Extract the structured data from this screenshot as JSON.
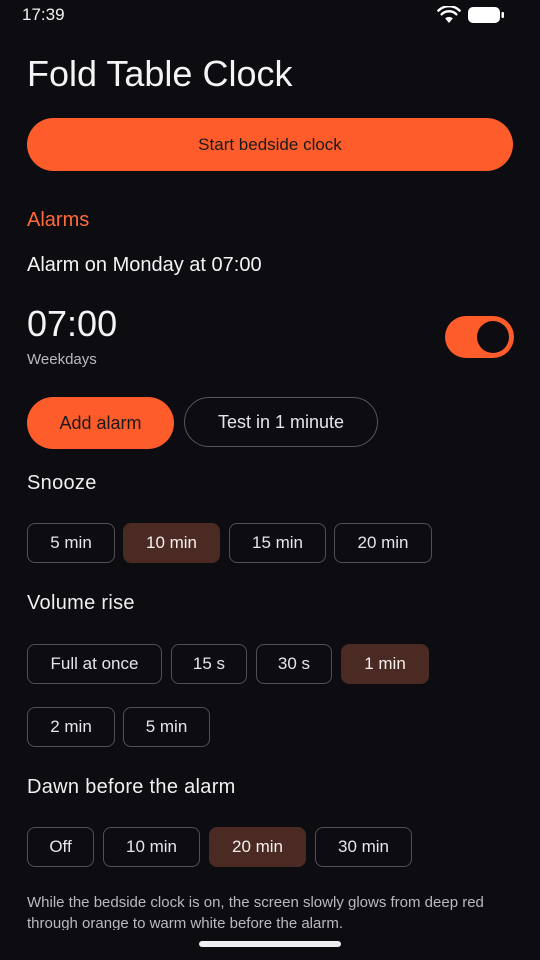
{
  "status_bar": {
    "time": "17:39"
  },
  "header": {
    "title": "Fold Table Clock"
  },
  "actions": {
    "start_bedside_clock": "Start bedside clock"
  },
  "alarms": {
    "heading": "Alarms",
    "summary": "Alarm on Monday at 07:00",
    "time": "07:00",
    "repeat": "Weekdays",
    "enabled": true,
    "add_alarm": "Add alarm",
    "test_alarm": "Test in 1 minute"
  },
  "snooze": {
    "label": "Snooze",
    "options": [
      "5 min",
      "10 min",
      "15 min",
      "20 min"
    ],
    "selected": "10 min"
  },
  "volume_rise": {
    "label": "Volume rise",
    "options": [
      "Full at once",
      "15 s",
      "30 s",
      "1 min",
      "2 min",
      "5 min"
    ],
    "selected": "1 min"
  },
  "dawn": {
    "label": "Dawn before the alarm",
    "options": [
      "Off",
      "10 min",
      "20 min",
      "30 min"
    ],
    "selected": "20 min"
  },
  "note": "While the bedside clock is on, the screen slowly glows from deep red through orange to warm white before the alarm.",
  "colors": {
    "accent": "#ff5c2b",
    "background": "#0c0c11",
    "selected_chip": "#4a2a22"
  }
}
